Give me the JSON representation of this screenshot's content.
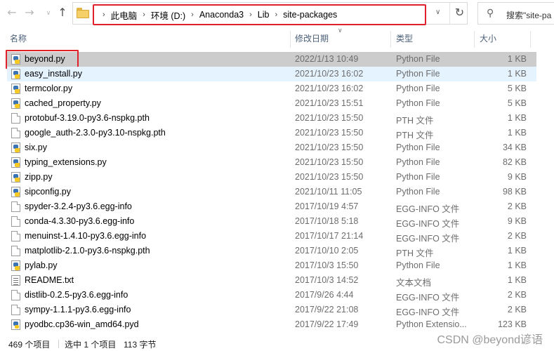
{
  "nav": {
    "back_icon": "arrow-left-icon",
    "forward_icon": "arrow-right-icon",
    "up_icon": "arrow-up-icon",
    "breadcrumbs": [
      "此电脑",
      "环境 (D:)",
      "Anaconda3",
      "Lib",
      "site-packages"
    ],
    "search_placeholder": "搜索\"site-pa"
  },
  "columns": {
    "name": "名称",
    "date": "修改日期",
    "type": "类型",
    "size": "大小"
  },
  "files": [
    {
      "name": "beyond.py",
      "date": "2022/1/13 10:49",
      "type": "Python File",
      "size": "1 KB",
      "icon": "python-file-icon"
    },
    {
      "name": "easy_install.py",
      "date": "2021/10/23 16:02",
      "type": "Python File",
      "size": "1 KB",
      "icon": "python-file-icon"
    },
    {
      "name": "termcolor.py",
      "date": "2021/10/23 16:02",
      "type": "Python File",
      "size": "5 KB",
      "icon": "python-file-icon"
    },
    {
      "name": "cached_property.py",
      "date": "2021/10/23 15:51",
      "type": "Python File",
      "size": "5 KB",
      "icon": "python-file-icon"
    },
    {
      "name": "protobuf-3.19.0-py3.6-nspkg.pth",
      "date": "2021/10/23 15:50",
      "type": "PTH 文件",
      "size": "1 KB",
      "icon": "file-icon"
    },
    {
      "name": "google_auth-2.3.0-py3.10-nspkg.pth",
      "date": "2021/10/23 15:50",
      "type": "PTH 文件",
      "size": "1 KB",
      "icon": "file-icon"
    },
    {
      "name": "six.py",
      "date": "2021/10/23 15:50",
      "type": "Python File",
      "size": "34 KB",
      "icon": "python-file-icon"
    },
    {
      "name": "typing_extensions.py",
      "date": "2021/10/23 15:50",
      "type": "Python File",
      "size": "82 KB",
      "icon": "python-file-icon"
    },
    {
      "name": "zipp.py",
      "date": "2021/10/23 15:50",
      "type": "Python File",
      "size": "9 KB",
      "icon": "python-file-icon"
    },
    {
      "name": "sipconfig.py",
      "date": "2021/10/11 11:05",
      "type": "Python File",
      "size": "98 KB",
      "icon": "python-file-icon"
    },
    {
      "name": "spyder-3.2.4-py3.6.egg-info",
      "date": "2017/10/19 4:57",
      "type": "EGG-INFO 文件",
      "size": "2 KB",
      "icon": "file-icon"
    },
    {
      "name": "conda-4.3.30-py3.6.egg-info",
      "date": "2017/10/18 5:18",
      "type": "EGG-INFO 文件",
      "size": "9 KB",
      "icon": "file-icon"
    },
    {
      "name": "menuinst-1.4.10-py3.6.egg-info",
      "date": "2017/10/17 21:14",
      "type": "EGG-INFO 文件",
      "size": "2 KB",
      "icon": "file-icon"
    },
    {
      "name": "matplotlib-2.1.0-py3.6-nspkg.pth",
      "date": "2017/10/10 2:05",
      "type": "PTH 文件",
      "size": "1 KB",
      "icon": "file-icon"
    },
    {
      "name": "pylab.py",
      "date": "2017/10/3 15:50",
      "type": "Python File",
      "size": "1 KB",
      "icon": "python-file-icon"
    },
    {
      "name": "README.txt",
      "date": "2017/10/3 14:52",
      "type": "文本文档",
      "size": "1 KB",
      "icon": "text-file-icon"
    },
    {
      "name": "distlib-0.2.5-py3.6.egg-info",
      "date": "2017/9/26 4:44",
      "type": "EGG-INFO 文件",
      "size": "2 KB",
      "icon": "file-icon"
    },
    {
      "name": "sympy-1.1.1-py3.6.egg-info",
      "date": "2017/9/22 21:08",
      "type": "EGG-INFO 文件",
      "size": "2 KB",
      "icon": "file-icon"
    },
    {
      "name": "pyodbc.cp36-win_amd64.pyd",
      "date": "2017/9/22 17:49",
      "type": "Python Extensio...",
      "size": "123 KB",
      "icon": "python-extension-icon"
    }
  ],
  "status": {
    "item_count": "469 个项目",
    "selected": "选中 1 个项目",
    "selected_size": "113 字节"
  },
  "watermark": "CSDN @beyond谚语",
  "colors": {
    "highlight_border": "#e0202a",
    "selected_row": "#cccccc",
    "hover_row": "#e5f3ff"
  }
}
